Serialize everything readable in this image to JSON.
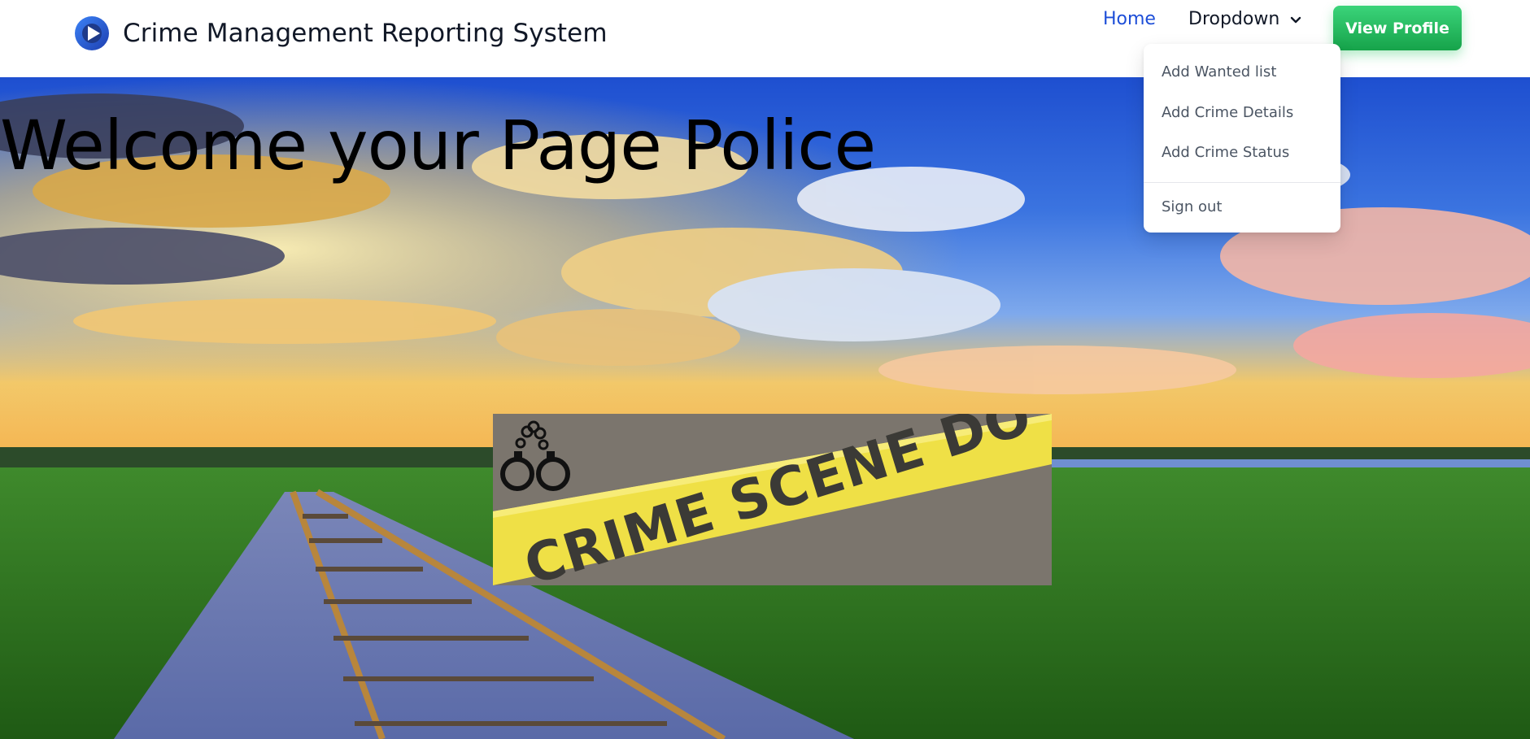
{
  "header": {
    "title": "Crime Management Reporting System",
    "nav": {
      "home": "Home",
      "dropdown": "Dropdown"
    },
    "profile_button": "View Profile",
    "logo_icon": "play-circle-icon"
  },
  "dropdown_menu": {
    "items": [
      "Add Wanted list",
      "Add Crime Details",
      "Add Crime Status"
    ],
    "sign_out": "Sign out"
  },
  "hero": {
    "heading": "Welcome your Page Police",
    "banner": {
      "tape_text": "CRIME SCENE DO NOT CROSS",
      "icon": "handcuffs-icon"
    }
  },
  "colors": {
    "link_active": "#1d4ed8",
    "button_green": "#22c55e",
    "tape_yellow": "#f2e14a"
  }
}
